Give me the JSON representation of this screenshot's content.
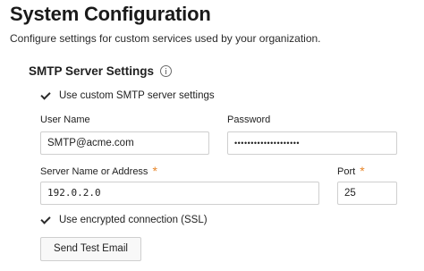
{
  "header": {
    "title": "System Configuration",
    "description": "Configure settings for custom services used by your organization."
  },
  "smtp": {
    "section_title": "SMTP Server Settings",
    "info_icon": "info-circle-icon",
    "use_custom": {
      "label": "Use custom SMTP server settings",
      "checked": true
    },
    "user_name": {
      "label": "User Name",
      "value": "SMTP@acme.com"
    },
    "password": {
      "label": "Password",
      "value": "••••••••••••••••••••"
    },
    "server": {
      "label": "Server Name or Address",
      "required": "*",
      "value": "192.0.2.0"
    },
    "port": {
      "label": "Port",
      "required": "*",
      "value": "25"
    },
    "ssl": {
      "label": "Use encrypted connection (SSL)",
      "checked": true
    },
    "test_button": "Send Test Email"
  },
  "colors": {
    "required_marker": "#e8862a",
    "input_border": "#cfcfcf"
  }
}
